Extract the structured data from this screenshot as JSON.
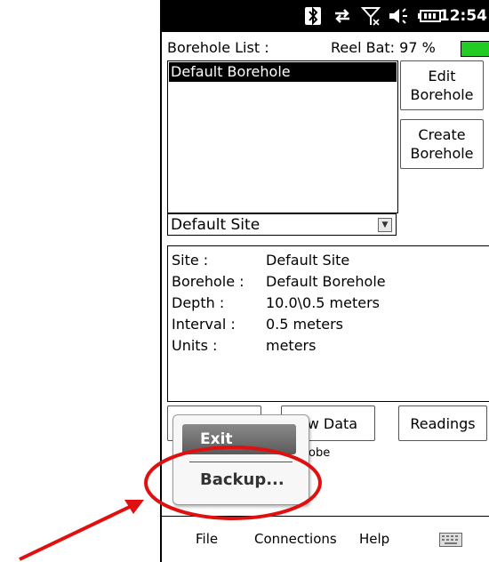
{
  "status": {
    "icons": [
      "bluetooth-icon",
      "sync-icon",
      "no-signal-icon",
      "speaker-icon",
      "battery-icon"
    ],
    "time": "12:54"
  },
  "header": {
    "borehole_list_label": "Borehole List :",
    "reel_bat_label": "Reel Bat: 97 %",
    "battery_percent": 97,
    "battery_color": "#22cc22"
  },
  "borehole_list": {
    "items": [
      "Default Borehole"
    ],
    "selected_index": 0
  },
  "buttons": {
    "edit_line1": "Edit",
    "edit_line2": "Borehole",
    "create_line1": "Create",
    "create_line2": "Borehole",
    "view_data": "ew Data",
    "readings": "Readings"
  },
  "site_dropdown": {
    "selected": "Default Site"
  },
  "info": {
    "rows": [
      {
        "key": "Site :",
        "value": "Default Site"
      },
      {
        "key": "Borehole :",
        "value": "Default Borehole"
      },
      {
        "key": "Depth :",
        "value": "10.0\\0.5 meters"
      },
      {
        "key": "Interval :",
        "value": "0.5 meters"
      },
      {
        "key": "Units :",
        "value": "meters"
      }
    ]
  },
  "partial_text": {
    "probe": "robe"
  },
  "menu_popup": {
    "exit": "Exit",
    "backup": "Backup..."
  },
  "tabbar": {
    "file": "File",
    "connections": "Connections",
    "help": "Help",
    "keyboard_icon": "keyboard-icon"
  },
  "annotation": {
    "highlight_color": "#e01010"
  }
}
